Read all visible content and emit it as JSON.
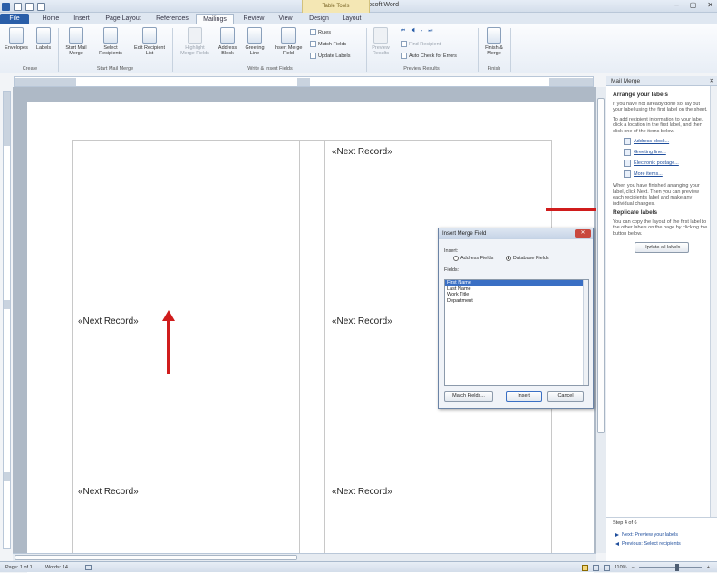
{
  "window": {
    "title": "Document2 - Microsoft Word",
    "context_tab": "Table Tools",
    "min": "–",
    "max": "▢",
    "close": "✕"
  },
  "tabs": [
    "File",
    "Home",
    "Insert",
    "Page Layout",
    "References",
    "Mailings",
    "Review",
    "View",
    "Design",
    "Layout"
  ],
  "active_tab": "Mailings",
  "ribbon": {
    "create": {
      "label": "Create",
      "envelopes": "Envelopes",
      "labels": "Labels"
    },
    "start": {
      "label": "Start Mail Merge",
      "start": "Start Mail Merge",
      "select": "Select Recipients",
      "edit": "Edit Recipient List"
    },
    "write": {
      "label": "Write & Insert Fields",
      "highlight": "Highlight Merge Fields",
      "address": "Address Block",
      "greeting": "Greeting Line",
      "insert": "Insert Merge Field",
      "rules": "Rules",
      "match": "Match Fields",
      "update": "Update Labels"
    },
    "preview": {
      "label": "Preview Results",
      "preview": "Preview Results",
      "find": "Find Recipient",
      "auto": "Auto Check for Errors"
    },
    "finish": {
      "label": "Finish",
      "finish": "Finish & Merge"
    }
  },
  "document": {
    "next_record": "«Next Record»"
  },
  "taskpane": {
    "title": "Mail Merge",
    "close": "✕",
    "heading": "Arrange your labels",
    "p1": "If you have not already done so, lay out your label using the first label on the sheet.",
    "p2": "To add recipient information to your label, click a location in the first label, and then click one of the items below.",
    "links": [
      "Address block...",
      "Greeting line...",
      "Electronic postage...",
      "More items..."
    ],
    "p3": "When you have finished arranging your label, click Next. Then you can preview each recipient's label and make any individual changes.",
    "replicate_heading": "Replicate labels",
    "p4": "You can copy the layout of the first label to the other labels on the page by clicking the button below.",
    "update_button": "Update all labels",
    "step": "Step 4 of 6",
    "next": "Next: Preview your labels",
    "previous": "Previous: Select recipients"
  },
  "dialog": {
    "title": "Insert Merge Field",
    "close": "✕",
    "insert_label": "Insert:",
    "opt_address": "Address Fields",
    "opt_database": "Database Fields",
    "fields_label": "Fields:",
    "fields": [
      "First Name",
      "Last Name",
      "Work Title",
      "Department"
    ],
    "selected_field": "First Name",
    "match_button": "Match Fields...",
    "insert_button": "Insert",
    "cancel_button": "Cancel"
  },
  "status": {
    "page": "Page: 1 of 1",
    "words": "Words: 14",
    "zoom": "110%"
  }
}
